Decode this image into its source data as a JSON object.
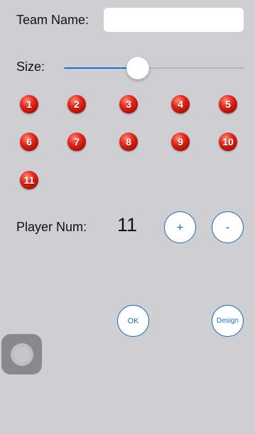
{
  "team": {
    "label": "Team Name:",
    "value": "",
    "placeholder": ""
  },
  "size": {
    "label": "Size:",
    "value_fraction": 0.41,
    "accent_color": "#1f6fd6"
  },
  "players": {
    "balls": [
      "1",
      "2",
      "3",
      "4",
      "5",
      "6",
      "7",
      "8",
      "9",
      "10",
      "11"
    ],
    "ball_color": "#c8140c"
  },
  "player_num": {
    "label": "Player Num:",
    "count": "11",
    "plus_label": "+",
    "minus_label": "-"
  },
  "actions": {
    "ok_label": "OK",
    "design_label": "Design"
  },
  "button_color": "#1f6fb3",
  "background_color": "#cfced3"
}
